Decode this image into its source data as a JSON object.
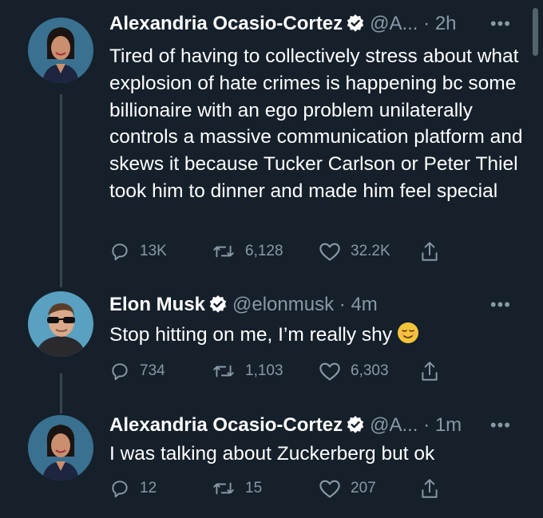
{
  "tweets": [
    {
      "author": "Alexandria Ocasio-Cortez",
      "handle": "@A...",
      "dot": "·",
      "time": "2h",
      "text": "Tired of having to collectively stress about what explosion of hate crimes is happening bc some billionaire with an ego problem unilaterally controls a massive communication platform and skews it because Tucker Carlson or Peter Thiel took him to dinner and made him feel special",
      "replies": "13K",
      "retweets": "6,128",
      "likes": "32.2K"
    },
    {
      "author": "Elon Musk",
      "handle": "@elonmusk",
      "dot": "·",
      "time": "4m",
      "text": "Stop hitting on me, I’m really shy",
      "emoji": "relieved-face-emoji",
      "replies": "734",
      "retweets": "1,103",
      "likes": "6,303"
    },
    {
      "author": "Alexandria Ocasio-Cortez",
      "handle": "@A...",
      "dot": "·",
      "time": "1m",
      "text": "I was talking about Zuckerberg but ok",
      "replies": "12",
      "retweets": "15",
      "likes": "207"
    }
  ],
  "more_glyph": "•••",
  "icons": {
    "reply": "reply-icon",
    "retweet": "retweet-icon",
    "like": "like-icon",
    "share": "share-icon",
    "verified": "verified-badge-icon",
    "more": "more-icon"
  },
  "colors": {
    "background": "#15202b",
    "secondary_text": "#8899a6",
    "thread_line": "#38444d",
    "primary_text": "#ffffff"
  }
}
